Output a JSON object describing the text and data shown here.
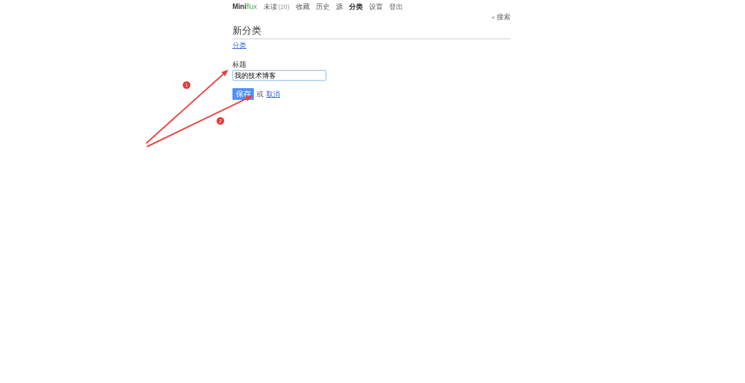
{
  "logo": {
    "part_1": "Mini",
    "part_2": "flux"
  },
  "nav": [
    {
      "label": "未读",
      "count": "(20)",
      "selected": false
    },
    {
      "label": "收藏",
      "selected": false
    },
    {
      "label": "历史",
      "selected": false
    },
    {
      "label": "源",
      "selected": false
    },
    {
      "label": "分类",
      "selected": true
    },
    {
      "label": "设置",
      "selected": false
    },
    {
      "label": "登出",
      "selected": false
    }
  ],
  "search_link": {
    "icon": "«",
    "label": "搜索"
  },
  "page_title": "新分类",
  "breadcrumb": "分类",
  "form": {
    "label": "标题",
    "value": "我的技术博客",
    "save_button": "保存",
    "or_text": "或",
    "cancel_link": "取消"
  },
  "annotations": [
    {
      "number": "1"
    },
    {
      "number": "2"
    }
  ]
}
